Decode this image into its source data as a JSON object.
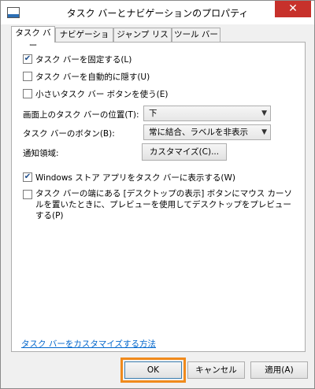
{
  "window": {
    "title": "タスク バーとナビゲーションのプロパティ",
    "close": "✕"
  },
  "tabs": [
    "タスク バー",
    "ナビゲーション",
    "ジャンプ リスト",
    "ツール バー"
  ],
  "options": {
    "lock": {
      "label": "タスク バーを固定する(L)",
      "checked": true
    },
    "autohide": {
      "label": "タスク バーを自動的に隠す(U)",
      "checked": false
    },
    "small": {
      "label": "小さいタスク バー ボタンを使う(E)",
      "checked": false
    },
    "store": {
      "label": "Windows ストア アプリをタスク バーに表示する(W)",
      "checked": true
    },
    "peek": {
      "label": "タスク バーの端にある [デスクトップの表示] ボタンにマウス カーソルを置いたときに、プレビューを使用してデスクトップをプレビューする(P)",
      "checked": false
    }
  },
  "position": {
    "label": "画面上のタスク バーの位置(T):",
    "value": "下"
  },
  "buttons_setting": {
    "label": "タスク バーのボタン(B):",
    "value": "常に結合、ラベルを非表示"
  },
  "notification": {
    "label": "通知領域:",
    "button": "カスタマイズ(C)..."
  },
  "link": "タスク バーをカスタマイズする方法",
  "footer": {
    "ok": "OK",
    "cancel": "キャンセル",
    "apply": "適用(A)"
  },
  "icons": {
    "checkmark": "✔",
    "chevron": "▼"
  },
  "colors": {
    "highlight": "#f08a1c",
    "close": "#c7312b",
    "link": "#0066cc"
  }
}
